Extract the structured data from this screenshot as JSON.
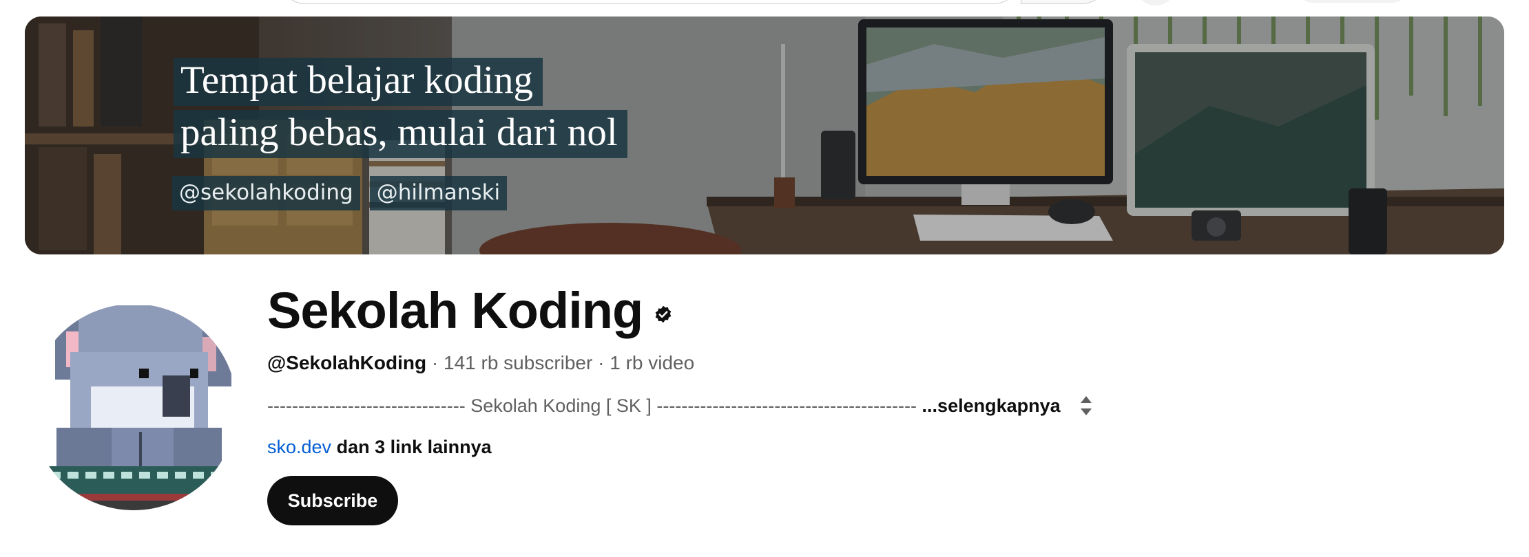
{
  "banner": {
    "tagline_line1": "Tempat belajar koding",
    "tagline_line2": "paling bebas, mulai dari nol",
    "handles": [
      "@sekolahkoding",
      "@hilmanski"
    ]
  },
  "channel": {
    "title": "Sekolah Koding",
    "verified_icon": "verified-check-icon",
    "handle": "@SekolahKoding",
    "subscribers": "141 rb subscriber",
    "videos": "1 rb video",
    "separator": " · ",
    "description_preview": "-------------------------------- Sekolah Koding [ SK ] ------------------------------------------",
    "more_label": "...selengkapnya",
    "link": "sko.dev",
    "more_links": "dan 3 link lainnya",
    "subscribe_label": "Subscribe"
  },
  "colors": {
    "link": "#065fd4",
    "subscribe_bg": "#0f0f0f",
    "banner_label_bg": "#1a3642"
  }
}
